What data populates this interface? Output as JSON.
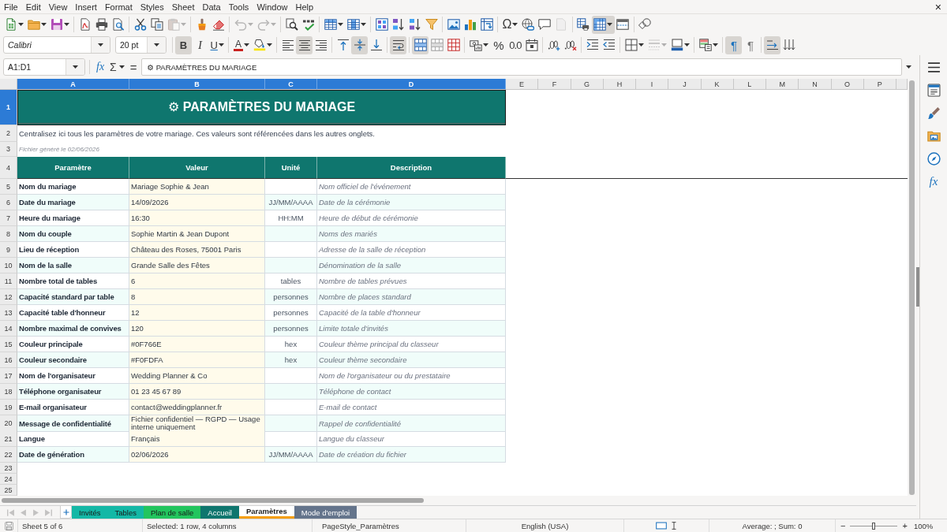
{
  "menu_bar": {
    "items": [
      "File",
      "Edit",
      "View",
      "Insert",
      "Format",
      "Styles",
      "Sheet",
      "Data",
      "Tools",
      "Window",
      "Help"
    ],
    "close": "×"
  },
  "standard_toolbar": {
    "groups": [
      [
        {
          "kind": "new",
          "menu": true,
          "pressed": false,
          "disabled": false
        },
        {
          "kind": "open",
          "menu": true,
          "pressed": false,
          "disabled": false
        },
        {
          "kind": "save",
          "menu": true,
          "pressed": false,
          "disabled": false
        }
      ],
      [
        {
          "kind": "pdf",
          "menu": false,
          "pressed": false,
          "disabled": false
        },
        {
          "kind": "print",
          "menu": false,
          "pressed": false,
          "disabled": false
        },
        {
          "kind": "preview",
          "menu": false,
          "pressed": false,
          "disabled": false
        }
      ],
      [
        {
          "kind": "cut",
          "menu": false,
          "pressed": false,
          "disabled": false
        },
        {
          "kind": "copy",
          "menu": false,
          "pressed": false,
          "disabled": false
        },
        {
          "kind": "paste",
          "menu": true,
          "pressed": false,
          "disabled": true
        }
      ],
      [
        {
          "kind": "clone",
          "menu": false,
          "pressed": false,
          "disabled": false
        },
        {
          "kind": "clear",
          "menu": false,
          "pressed": false,
          "disabled": false
        }
      ],
      [
        {
          "kind": "undo",
          "menu": true,
          "pressed": false,
          "disabled": true
        },
        {
          "kind": "redo",
          "menu": true,
          "pressed": false,
          "disabled": true
        }
      ],
      [
        {
          "kind": "find",
          "menu": false,
          "pressed": false,
          "disabled": false
        },
        {
          "kind": "spell",
          "menu": false,
          "pressed": false,
          "disabled": false
        }
      ],
      [
        {
          "kind": "row",
          "menu": true,
          "pressed": false,
          "disabled": false
        },
        {
          "kind": "column",
          "menu": true,
          "pressed": false,
          "disabled": false
        }
      ],
      [
        {
          "kind": "sort",
          "menu": false,
          "pressed": false,
          "disabled": false
        },
        {
          "kind": "sort_asc",
          "menu": false,
          "pressed": false,
          "disabled": false
        },
        {
          "kind": "sort_desc",
          "menu": false,
          "pressed": false,
          "disabled": false
        },
        {
          "kind": "filter",
          "menu": false,
          "pressed": false,
          "disabled": false
        }
      ],
      [
        {
          "kind": "image",
          "menu": false,
          "pressed": false,
          "disabled": false
        },
        {
          "kind": "chart",
          "menu": false,
          "pressed": false,
          "disabled": false
        },
        {
          "kind": "pivot",
          "menu": false,
          "pressed": false,
          "disabled": false
        }
      ],
      [
        {
          "kind": "special",
          "glyph": "Ω",
          "menu": true,
          "pressed": false,
          "disabled": false
        },
        {
          "kind": "link",
          "menu": false,
          "pressed": false,
          "disabled": false
        },
        {
          "kind": "comment",
          "menu": false,
          "pressed": false,
          "disabled": false
        },
        {
          "kind": "header_footer",
          "menu": false,
          "pressed": false,
          "disabled": true
        }
      ],
      [
        {
          "kind": "print_area",
          "menu": false,
          "pressed": false,
          "disabled": false
        },
        {
          "kind": "freeze",
          "menu": true,
          "pressed": true,
          "disabled": false
        },
        {
          "kind": "split",
          "menu": false,
          "pressed": false,
          "disabled": false
        }
      ],
      [
        {
          "kind": "draw",
          "menu": false,
          "pressed": false,
          "disabled": false
        }
      ]
    ]
  },
  "formatting_toolbar": {
    "font_name": "Calibri",
    "font_size": "20 pt",
    "groups": [
      [
        {
          "kind": "bold",
          "glyph": "B",
          "menu": false,
          "pressed": true,
          "disabled": false
        },
        {
          "kind": "italic",
          "glyph": "I",
          "menu": false,
          "pressed": false,
          "disabled": false
        },
        {
          "kind": "underline",
          "glyph": "U",
          "menu": true,
          "pressed": false,
          "disabled": false
        }
      ],
      [
        {
          "kind": "font_color",
          "glyph": "A",
          "menu": true,
          "pressed": false,
          "disabled": false
        },
        {
          "kind": "highlight",
          "menu": true,
          "pressed": false,
          "disabled": false
        }
      ],
      [
        {
          "kind": "align_left",
          "menu": false,
          "pressed": false,
          "disabled": false
        },
        {
          "kind": "align_center",
          "menu": false,
          "pressed": true,
          "disabled": false
        },
        {
          "kind": "align_right",
          "menu": false,
          "pressed": false,
          "disabled": false
        }
      ],
      [
        {
          "kind": "valign_top",
          "menu": false,
          "pressed": false,
          "disabled": false
        },
        {
          "kind": "valign_center",
          "menu": false,
          "pressed": true,
          "disabled": false
        },
        {
          "kind": "valign_bottom",
          "menu": false,
          "pressed": false,
          "disabled": false
        }
      ],
      [
        {
          "kind": "wrap",
          "menu": false,
          "pressed": true,
          "disabled": false
        }
      ],
      [
        {
          "kind": "merge_center",
          "menu": false,
          "pressed": true,
          "disabled": false
        },
        {
          "kind": "merge",
          "menu": false,
          "pressed": false,
          "disabled": false
        },
        {
          "kind": "unmerge",
          "menu": false,
          "pressed": false,
          "disabled": false
        }
      ],
      [
        {
          "kind": "currency",
          "menu": true,
          "pressed": false,
          "disabled": false
        },
        {
          "kind": "percent",
          "glyph": "%",
          "menu": false,
          "pressed": false,
          "disabled": false
        },
        {
          "kind": "number",
          "glyph": "0.0",
          "menu": false,
          "pressed": false,
          "disabled": false
        },
        {
          "kind": "date",
          "menu": false,
          "pressed": false,
          "disabled": false
        }
      ],
      [
        {
          "kind": "add_decimal",
          "menu": false,
          "pressed": false,
          "disabled": false
        },
        {
          "kind": "del_decimal",
          "menu": false,
          "pressed": false,
          "disabled": false
        }
      ],
      [
        {
          "kind": "indent",
          "menu": false,
          "pressed": false,
          "disabled": false
        },
        {
          "kind": "outdent",
          "menu": false,
          "pressed": false,
          "disabled": false
        }
      ],
      [
        {
          "kind": "borders",
          "menu": true,
          "pressed": false,
          "disabled": false
        },
        {
          "kind": "border_style",
          "menu": true,
          "pressed": false,
          "disabled": true
        },
        {
          "kind": "border_color",
          "menu": true,
          "pressed": false,
          "disabled": false
        }
      ],
      [
        {
          "kind": "conditional",
          "menu": true,
          "pressed": false,
          "disabled": false
        }
      ],
      [
        {
          "kind": "ltr",
          "glyph": "¶",
          "menu": false,
          "pressed": true,
          "disabled": false
        },
        {
          "kind": "rtl",
          "glyph": "¶",
          "menu": false,
          "pressed": false,
          "disabled": false
        }
      ],
      [
        {
          "kind": "text_dir",
          "menu": false,
          "pressed": true,
          "disabled": false
        },
        {
          "kind": "stacked",
          "menu": false,
          "pressed": false,
          "disabled": false
        }
      ]
    ]
  },
  "formula_bar": {
    "name_box": "A1:D1",
    "function_wizard": "fx",
    "sum": "Σ",
    "equals": "=",
    "content": "⚙ PARAMÈTRES DU MARIAGE"
  },
  "sidebar": {
    "buttons": [
      {
        "kind": "menu"
      },
      {
        "kind": "properties"
      },
      {
        "kind": "styles"
      },
      {
        "kind": "gallery"
      },
      {
        "kind": "navigator"
      },
      {
        "kind": "functions",
        "glyph": "fx"
      }
    ]
  },
  "sheet": {
    "column_headers": [
      {
        "label": "A",
        "selected": true
      },
      {
        "label": "B",
        "selected": true
      },
      {
        "label": "C",
        "selected": true
      },
      {
        "label": "D",
        "selected": true
      },
      {
        "label": "E",
        "selected": false
      },
      {
        "label": "F",
        "selected": false
      },
      {
        "label": "G",
        "selected": false
      },
      {
        "label": "H",
        "selected": false
      },
      {
        "label": "I",
        "selected": false
      },
      {
        "label": "J",
        "selected": false
      },
      {
        "label": "K",
        "selected": false
      },
      {
        "label": "L",
        "selected": false
      },
      {
        "label": "M",
        "selected": false
      },
      {
        "label": "N",
        "selected": false
      },
      {
        "label": "O",
        "selected": false
      },
      {
        "label": "P",
        "selected": false
      }
    ],
    "row_headers": [
      {
        "label": "1",
        "selected": true
      },
      {
        "label": "2",
        "selected": false
      },
      {
        "label": "3",
        "selected": false
      },
      {
        "label": "4",
        "selected": false
      },
      {
        "label": "5",
        "selected": false
      },
      {
        "label": "6",
        "selected": false
      },
      {
        "label": "7",
        "selected": false
      },
      {
        "label": "8",
        "selected": false
      },
      {
        "label": "9",
        "selected": false
      },
      {
        "label": "10",
        "selected": false
      },
      {
        "label": "11",
        "selected": false
      },
      {
        "label": "12",
        "selected": false
      },
      {
        "label": "13",
        "selected": false
      },
      {
        "label": "14",
        "selected": false
      },
      {
        "label": "15",
        "selected": false
      },
      {
        "label": "16",
        "selected": false
      },
      {
        "label": "17",
        "selected": false
      },
      {
        "label": "18",
        "selected": false
      },
      {
        "label": "19",
        "selected": false
      },
      {
        "label": "20",
        "selected": false
      },
      {
        "label": "21",
        "selected": false
      },
      {
        "label": "22",
        "selected": false
      },
      {
        "label": "23",
        "selected": false
      },
      {
        "label": "24",
        "selected": false
      },
      {
        "label": "25",
        "selected": false
      }
    ],
    "title": {
      "text": "⚙ PARAMÈTRES DU MARIAGE",
      "selected": true
    },
    "intro": "Centralisez ici tous les paramètres de votre mariage. Ces valeurs sont référencées dans les autres onglets.",
    "generated_note": "Fichier généré le 02/06/2026",
    "table": {
      "columns": [
        "Paramètre",
        "Valeur",
        "Unité",
        "Description"
      ],
      "rows": [
        {
          "parameter": "Nom du mariage",
          "value": "Mariage Sophie & Jean",
          "description": "Nom officiel de l'événement"
        },
        {
          "parameter": "Date du mariage",
          "value": "14/09/2026",
          "unit": "JJ/MM/AAAA",
          "description": "Date de la cérémonie"
        },
        {
          "parameter": "Heure du mariage",
          "value": "16:30",
          "unit": "HH:MM",
          "description": "Heure de début de cérémonie"
        },
        {
          "parameter": "Nom du couple",
          "value": "Sophie Martin & Jean Dupont",
          "description": "Noms des mariés"
        },
        {
          "parameter": "Lieu de réception",
          "value": "Château des Roses, 75001 Paris",
          "description": "Adresse de la salle de réception"
        },
        {
          "parameter": "Nom de la salle",
          "value": "Grande Salle des Fêtes",
          "description": "Dénomination de la salle"
        },
        {
          "parameter": "Nombre total de tables",
          "value": "6",
          "unit": "tables",
          "description": "Nombre de tables prévues"
        },
        {
          "parameter": "Capacité standard par table",
          "value": "8",
          "unit": "personnes",
          "description": "Nombre de places standard"
        },
        {
          "parameter": "Capacité table d'honneur",
          "value": "12",
          "unit": "personnes",
          "description": "Capacité de la table d'honneur"
        },
        {
          "parameter": "Nombre maximal de convives",
          "value": "120",
          "unit": "personnes",
          "description": "Limite totale d'invités"
        },
        {
          "parameter": "Couleur principale",
          "value": "#0F766E",
          "unit": "hex",
          "description": "Couleur thème principal du classeur"
        },
        {
          "parameter": "Couleur secondaire",
          "value": "#F0FDFA",
          "unit": "hex",
          "description": "Couleur thème secondaire"
        },
        {
          "parameter": "Nom de l'organisateur",
          "value": "Wedding Planner & Co",
          "description": "Nom de l'organisateur ou du prestataire"
        },
        {
          "parameter": "Téléphone organisateur",
          "value": "01 23 45 67 89",
          "description": "Téléphone de contact"
        },
        {
          "parameter": "E-mail organisateur",
          "value": "contact@weddingplanner.fr",
          "description": "E-mail de contact"
        },
        {
          "parameter": "Message de confidentialité",
          "value": "Fichier confidentiel — RGPD — Usage interne uniquement",
          "description": "Rappel de confidentialité"
        },
        {
          "parameter": "Langue",
          "value": "Français",
          "description": "Langue du classeur"
        },
        {
          "parameter": "Date de génération",
          "value": "02/06/2026",
          "unit": "JJ/MM/AAAA",
          "description": "Date de création du fichier"
        }
      ]
    }
  },
  "sheet_tabs": {
    "navigation_disabled": true,
    "tabs": [
      {
        "label": "Invités",
        "color": "#14b8a6",
        "selected": false
      },
      {
        "label": "Tables",
        "color": "#14b8a6",
        "selected": false
      },
      {
        "label": "Plan de salle",
        "color": "#22c55e",
        "selected": false
      },
      {
        "label": "Accueil",
        "color": "#0f766e",
        "selected": false
      },
      {
        "label": "Paramètres",
        "color": "#f59e0b",
        "selected": true
      },
      {
        "label": "Mode d'emploi",
        "color": "#64748b",
        "selected": false
      }
    ]
  },
  "status_bar": {
    "sheet_position": "Sheet 5 of 6",
    "selection": "Selected: 1 row, 4 columns",
    "page_style": "PageStyle_Paramètres",
    "language": "English (USA)",
    "summary": "Average: ; Sum: 0",
    "zoom_out": "−",
    "zoom_in": "+",
    "zoom": {
      "level": 0.5
    },
    "zoom_percent": "100%"
  }
}
